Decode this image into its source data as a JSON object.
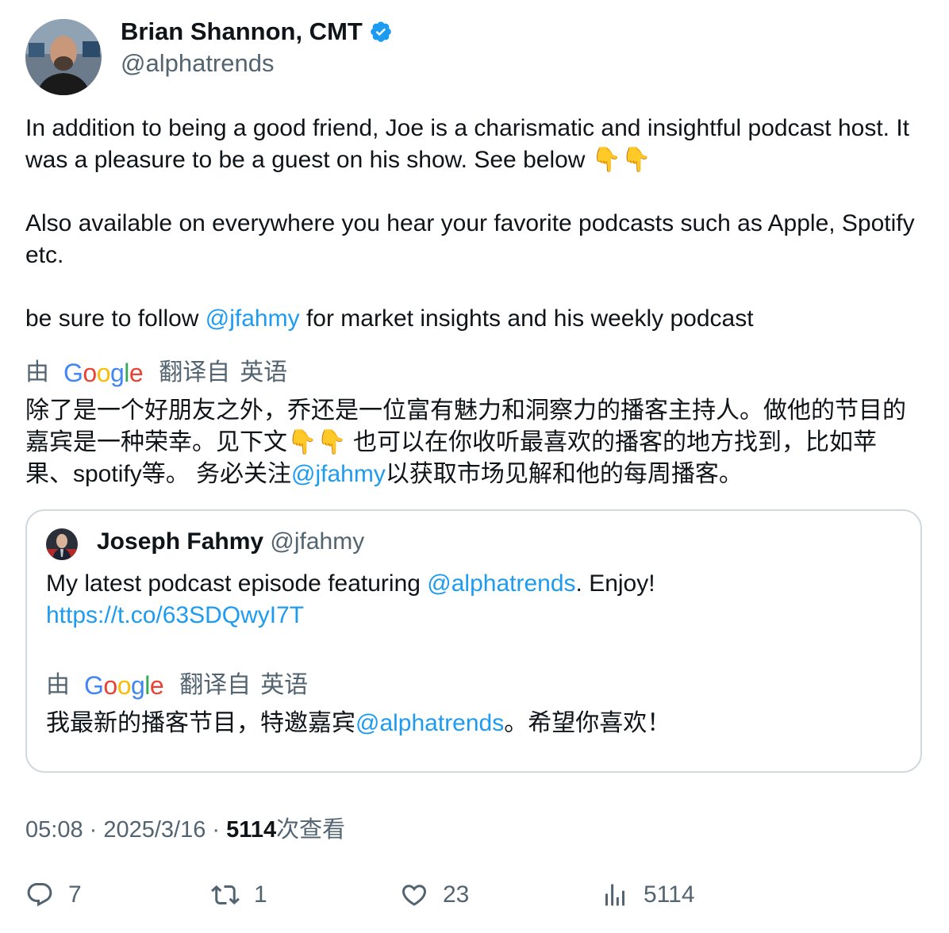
{
  "author": {
    "name": "Brian Shannon, CMT",
    "handle": "@alphatrends",
    "verified_color": "#1d9bf0",
    "avatar_icon": "avatar-photo"
  },
  "tweet": {
    "p1": "In addition to being a good friend, Joe is a charismatic and insightful podcast host.  It was a pleasure to be a guest on his show.  See below 👇👇",
    "p2": "Also available on everywhere you hear your favorite podcasts such as Apple, Spotify etc.",
    "p3_before": "be sure to follow ",
    "p3_mention": "@jfahmy",
    "p3_after": " for market insights and his weekly podcast"
  },
  "translation_bar": {
    "by": "由",
    "provider": "Google",
    "translated_from": "翻译自",
    "language": "英语"
  },
  "translation": {
    "part1": "除了是一个好朋友之外，乔还是一位富有魅力和洞察力的播客主持人。做他的节目的嘉宾是一种荣幸。见下文👇👇 也可以在你收听最喜欢的播客的地方找到，比如苹果、spotify等。 务必关注",
    "mention": "@jfahmy",
    "part2": "以获取市场见解和他的每周播客。"
  },
  "quote": {
    "name": "Joseph Fahmy",
    "handle": "@jfahmy",
    "text_before": "My latest podcast episode featuring ",
    "mention": "@alphatrends",
    "text_after": ". Enjoy!",
    "link": "https://t.co/63SDQwyI7T",
    "translation_before": "我最新的播客节目，特邀嘉宾",
    "translation_mention": "@alphatrends",
    "translation_after": "。希望你喜欢！"
  },
  "meta": {
    "time": "05:08",
    "sep1": " · ",
    "date": "2025/3/16",
    "sep2": " · ",
    "views": "5114",
    "views_label": "次查看"
  },
  "actions": {
    "replies": "7",
    "retweets": "1",
    "likes": "23",
    "views": "5114"
  },
  "colors": {
    "link": "#1d9bf0",
    "muted": "#536471",
    "text": "#0f1419",
    "border": "#cfd9de"
  }
}
